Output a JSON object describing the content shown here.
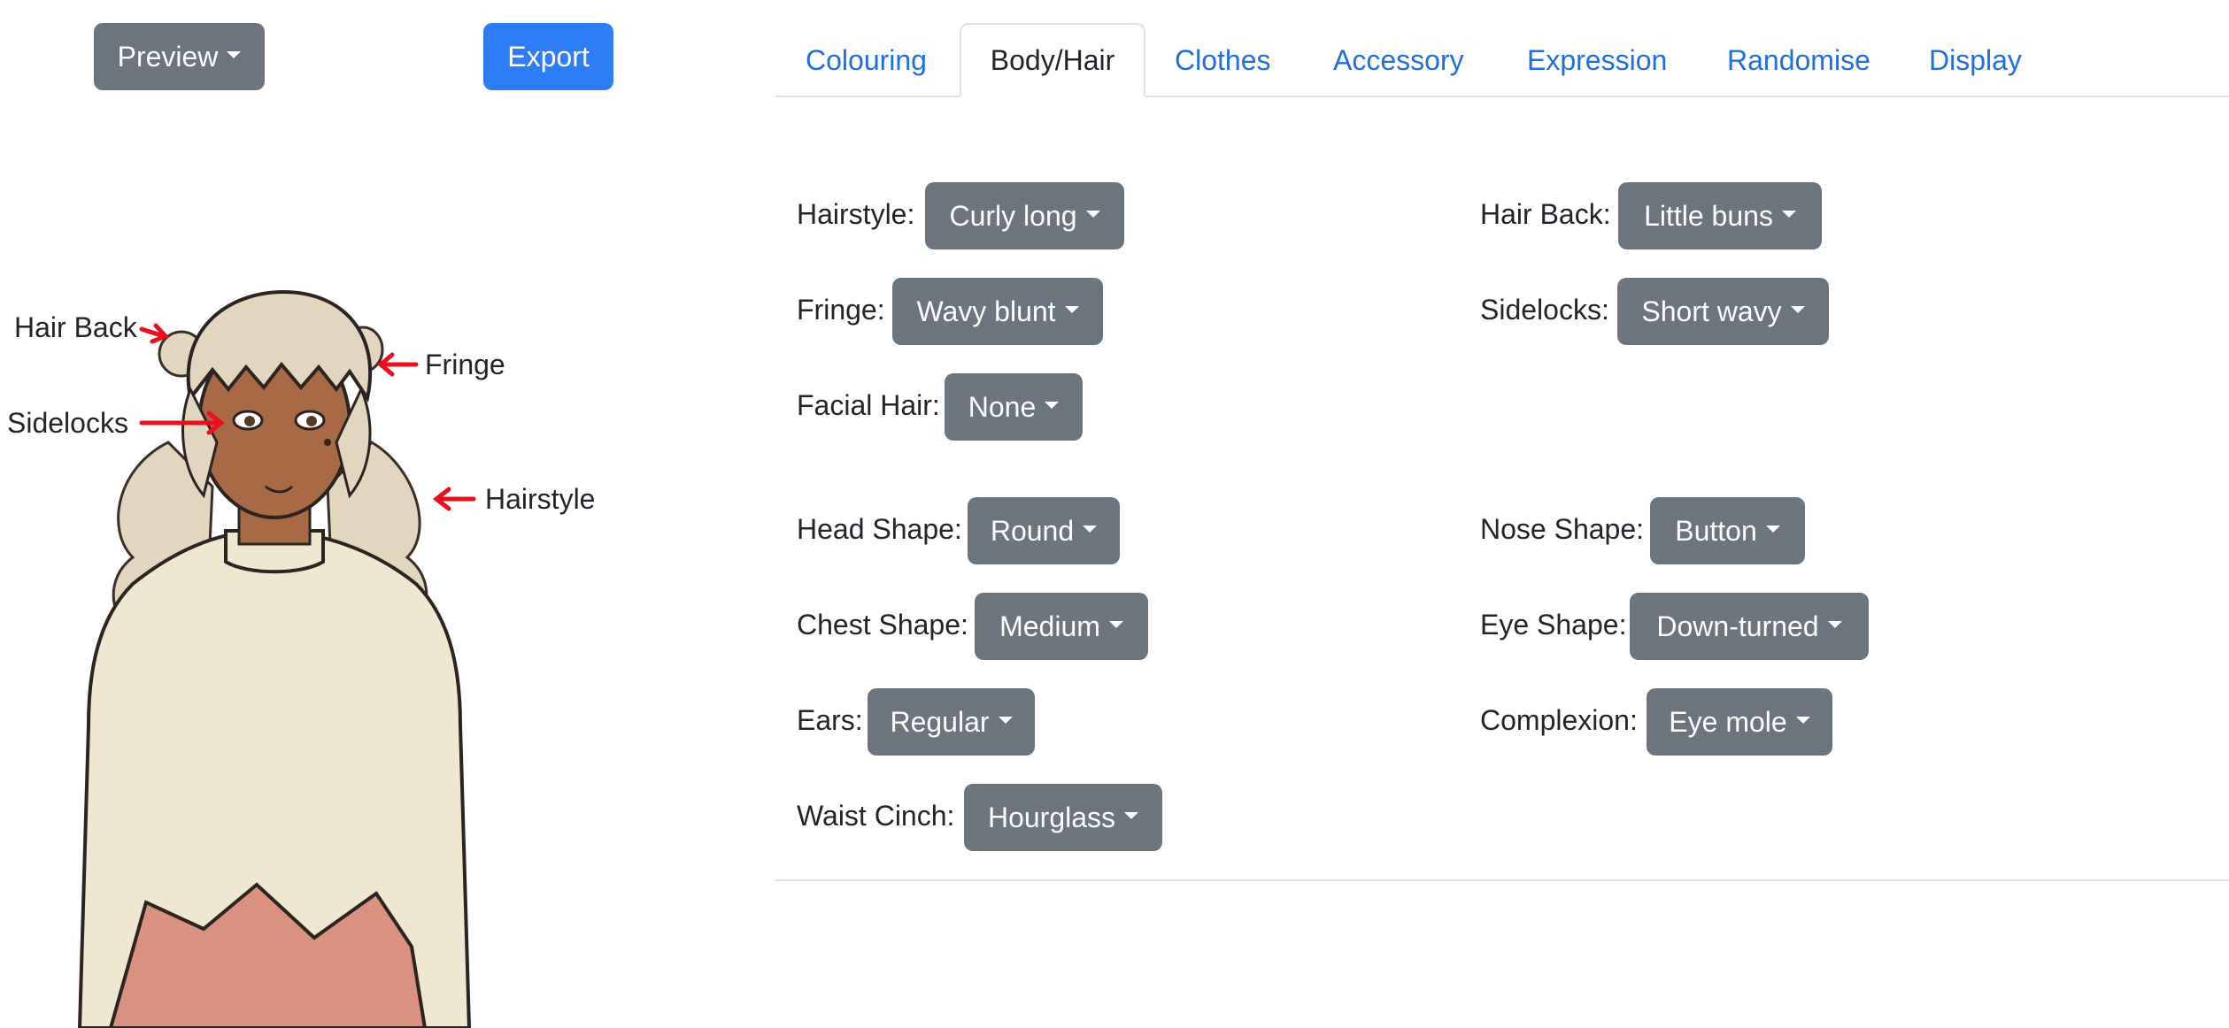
{
  "toolbar": {
    "preview_label": "Preview",
    "export_label": "Export"
  },
  "tabs": [
    {
      "label": "Colouring",
      "active": false
    },
    {
      "label": "Body/Hair",
      "active": true
    },
    {
      "label": "Clothes",
      "active": false
    },
    {
      "label": "Accessory",
      "active": false
    },
    {
      "label": "Expression",
      "active": false
    },
    {
      "label": "Randomise",
      "active": false
    },
    {
      "label": "Display",
      "active": false
    }
  ],
  "fields": {
    "hairstyle": {
      "label": "Hairstyle:",
      "value": "Curly long"
    },
    "hair_back": {
      "label": "Hair Back:",
      "value": "Little buns"
    },
    "fringe": {
      "label": "Fringe:",
      "value": "Wavy blunt"
    },
    "sidelocks": {
      "label": "Sidelocks:",
      "value": "Short wavy"
    },
    "facial_hair": {
      "label": "Facial Hair:",
      "value": "None"
    },
    "head_shape": {
      "label": "Head Shape:",
      "value": "Round"
    },
    "nose_shape": {
      "label": "Nose Shape:",
      "value": "Button"
    },
    "chest_shape": {
      "label": "Chest Shape:",
      "value": "Medium"
    },
    "eye_shape": {
      "label": "Eye Shape:",
      "value": "Down-turned"
    },
    "ears": {
      "label": "Ears:",
      "value": "Regular"
    },
    "complexion": {
      "label": "Complexion:",
      "value": "Eye mole"
    },
    "waist_cinch": {
      "label": "Waist Cinch:",
      "value": "Hourglass"
    }
  },
  "annotations": {
    "hair_back": "Hair Back",
    "fringe": "Fringe",
    "sidelocks": "Sidelocks",
    "hairstyle": "Hairstyle"
  },
  "colors": {
    "secondary": "#6c757d",
    "primary": "#2d7df6",
    "link": "#1f6fe0",
    "arrow": "#e8101c",
    "hair": "#e3d6bf",
    "skin": "#a86a45",
    "sweater": "#efe7cf",
    "skirt": "#d8927e"
  }
}
